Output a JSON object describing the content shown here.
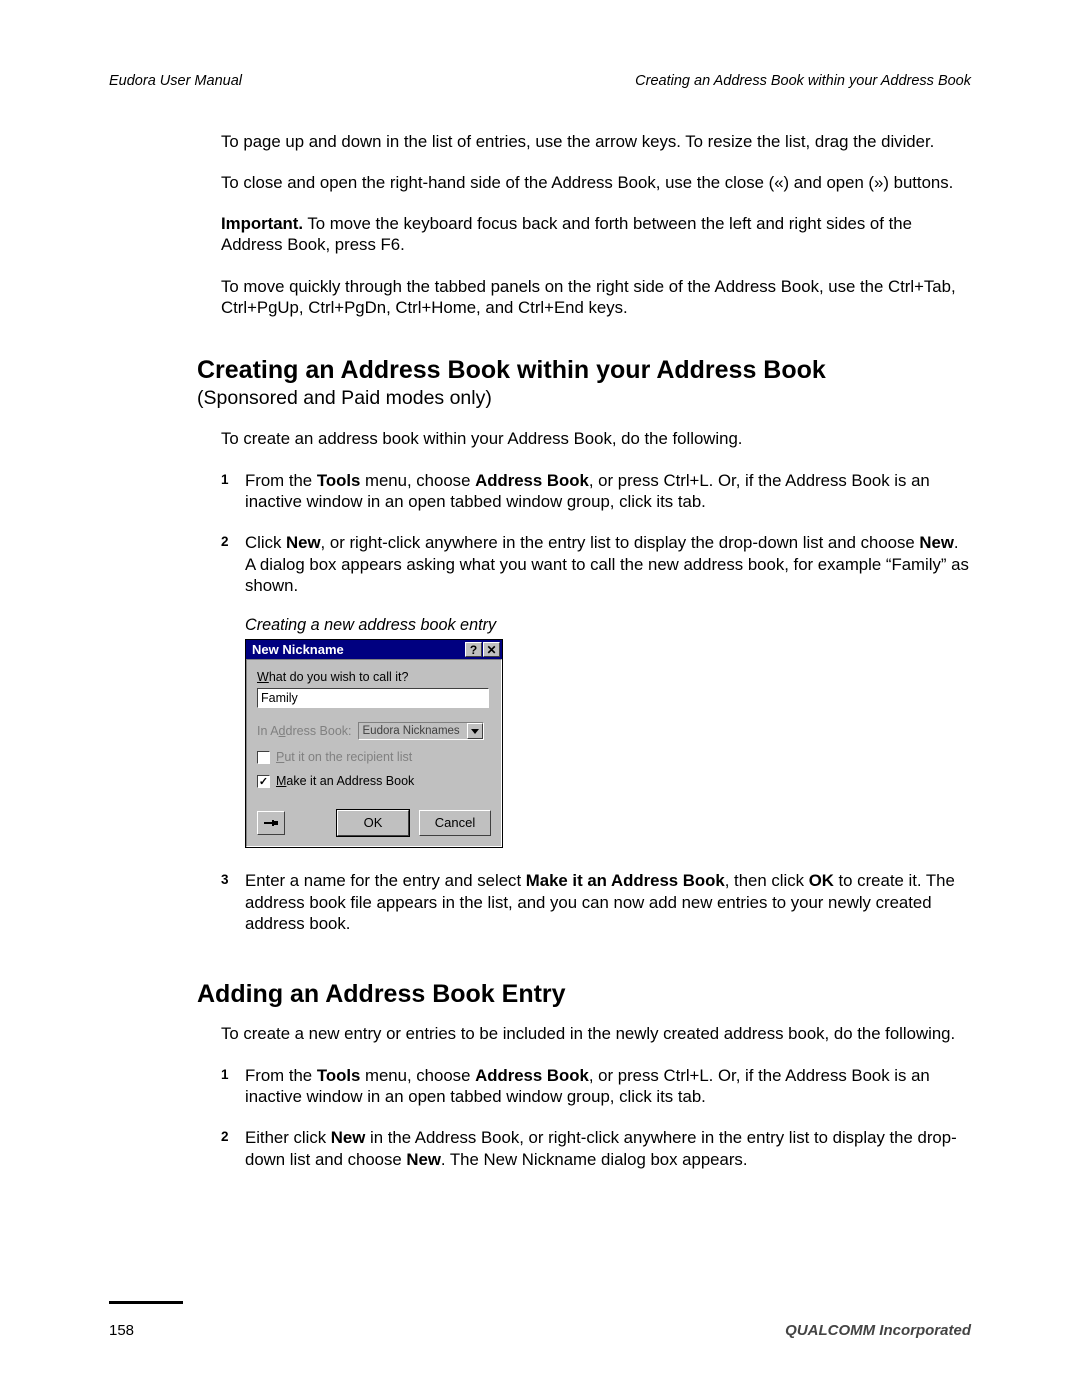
{
  "header": {
    "left": "Eudora User Manual",
    "right": "Creating an Address Book within your Address Book"
  },
  "intro": {
    "p1": "To page up and down in the list of entries, use the arrow keys. To resize the list, drag the divider.",
    "p2": "To close and open the right-hand side of the Address Book, use the close («) and open (») buttons.",
    "p3_lead": "Important.",
    "p3_rest": " To move the keyboard focus back and forth between the left and right sides of the Address Book, press F6.",
    "p4": "To move quickly through the tabbed panels on the right side of the Address Book, use the Ctrl+Tab, Ctrl+PgUp, Ctrl+PgDn, Ctrl+Home, and Ctrl+End keys."
  },
  "section1": {
    "title": "Creating an Address Book within your Address Book",
    "subtitle": "(Sponsored and Paid modes only)",
    "intro": "To create an address book within your Address Book, do the following.",
    "steps": [
      {
        "num": "1",
        "pre": "From the ",
        "b1": "Tools",
        "mid1": " menu, choose ",
        "b2": "Address Book",
        "post": ", or press Ctrl+L. Or, if the Address Book is an inactive window in an open tabbed window group, click its tab."
      },
      {
        "num": "2",
        "pre": "Click ",
        "b1": "New",
        "mid1": ", or right-click anywhere in the entry list to display the drop-down list and choose ",
        "b2": "New",
        "post": ". A dialog box appears asking what you want to call the new address book, for example “Family” as shown."
      },
      {
        "num": "3",
        "pre": "Enter a name for the entry and select ",
        "b1": "Make it an Address Book",
        "mid1": ", then click ",
        "b2": "OK",
        "post": " to create it. The address book file appears in the list, and you can now add new entries to your newly created address book."
      }
    ],
    "caption": "Creating a new address book entry"
  },
  "dialog": {
    "title": "New Nickname",
    "help_glyph": "?",
    "close_glyph": "✕",
    "label_call_it_pre": "W",
    "label_call_it_rest": "hat do you wish to call it?",
    "input_value": "Family",
    "in_book_pre": "In A",
    "in_book_mid": "d",
    "in_book_post": "dress Book:",
    "in_book_value": "Eudora Nicknames",
    "recipient_pre": "P",
    "recipient_rest": "ut it on the recipient list",
    "make_ab_pre": "M",
    "make_ab_rest": "ake it an Address Book",
    "ok": "OK",
    "cancel": "Cancel"
  },
  "section2": {
    "title": "Adding an Address Book Entry",
    "intro": "To create a new entry or entries to be included in the newly created address book, do the following.",
    "steps": [
      {
        "num": "1",
        "pre": "From the ",
        "b1": "Tools",
        "mid1": " menu, choose ",
        "b2": "Address Book",
        "post": ", or press Ctrl+L. Or, if the Address Book is an inactive window in an open tabbed window group, click its tab."
      },
      {
        "num": "2",
        "pre": "Either click ",
        "b1": "New",
        "mid1": " in the Address Book, or right-click anywhere in the entry list to display the drop-down list and choose ",
        "b2": "New",
        "post": ". The New Nickname dialog box appears."
      }
    ]
  },
  "footer": {
    "page": "158",
    "org": "QUALCOMM Incorporated"
  }
}
